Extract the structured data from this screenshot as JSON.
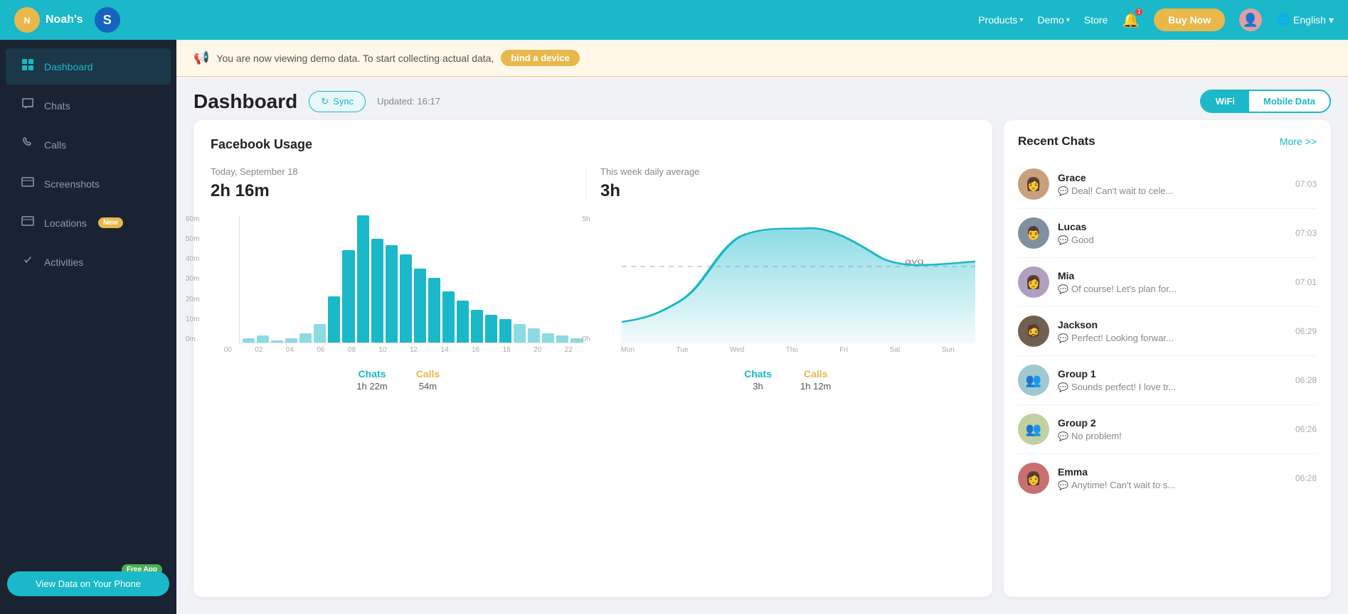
{
  "topNav": {
    "logoText": "Noah's",
    "logoIcon": "S",
    "products": "Products",
    "demo": "Demo",
    "store": "Store",
    "buyNow": "Buy Now",
    "language": "English"
  },
  "banner": {
    "text": "You are now viewing demo data. To start collecting actual data,",
    "bindBtn": "bind a device"
  },
  "dashboard": {
    "title": "Dashboard",
    "syncBtn": "Sync",
    "updated": "Updated: 16:17",
    "wifiBtn": "WiFi",
    "mobileDataBtn": "Mobile Data"
  },
  "sidebar": {
    "items": [
      {
        "id": "dashboard",
        "label": "Dashboard",
        "icon": "⊞",
        "active": true
      },
      {
        "id": "chats",
        "label": "Chats",
        "icon": "💬",
        "active": false
      },
      {
        "id": "calls",
        "label": "Calls",
        "icon": "📞",
        "active": false
      },
      {
        "id": "screenshots",
        "label": "Screenshots",
        "icon": "🖥",
        "active": false
      },
      {
        "id": "locations",
        "label": "Locations",
        "icon": "📋",
        "active": false,
        "badge": "New"
      },
      {
        "id": "activities",
        "label": "Activities",
        "icon": "✋",
        "active": false
      }
    ],
    "viewDataBtn": "View Data on Your Phone",
    "freeAppBadge": "Free App"
  },
  "facebookUsage": {
    "title": "Facebook Usage",
    "todayLabel": "Today, September 18",
    "todayTime": "2h 16m",
    "weekLabel": "This week daily average",
    "weekTime": "3h",
    "barChart": {
      "yLabels": [
        "60m",
        "50m",
        "40m",
        "30m",
        "20m",
        "10m",
        "0m"
      ],
      "xLabels": [
        "00",
        "02",
        "04",
        "06",
        "08",
        "10",
        "12",
        "14",
        "16",
        "18",
        "20",
        "22"
      ],
      "bars": [
        2,
        3,
        1,
        2,
        4,
        8,
        20,
        40,
        55,
        45,
        42,
        38,
        32,
        28,
        22,
        18,
        14,
        12,
        10,
        8,
        6,
        4,
        3,
        2
      ]
    },
    "lineChart": {
      "yLabels": [
        "5h",
        "",
        "",
        "",
        "0h"
      ],
      "xLabels": [
        "Mon",
        "Tue",
        "Wed",
        "Thu",
        "Fri",
        "Sat",
        "Sun"
      ],
      "avgLabel": "avg"
    },
    "legend": {
      "chatsLabel": "Chats",
      "chatsValue": "1h 22m",
      "callsLabel": "Calls",
      "callsValue": "54m",
      "chatsWeekLabel": "Chats",
      "chatsWeekValue": "3h",
      "callsWeekLabel": "Calls",
      "callsWeekValue": "1h 12m"
    }
  },
  "recentChats": {
    "title": "Recent Chats",
    "moreLink": "More >>",
    "items": [
      {
        "id": "grace",
        "name": "Grace",
        "preview": "Deal! Can't wait to cele...",
        "time": "07:03",
        "avatarClass": "av-grace",
        "emoji": "👩"
      },
      {
        "id": "lucas",
        "name": "Lucas",
        "preview": "Good",
        "time": "07:03",
        "avatarClass": "av-lucas",
        "emoji": "👨"
      },
      {
        "id": "mia",
        "name": "Mia",
        "preview": "Of course! Let's plan for...",
        "time": "07:01",
        "avatarClass": "av-mia",
        "emoji": "👩"
      },
      {
        "id": "jackson",
        "name": "Jackson",
        "preview": "Perfect! Looking forwar...",
        "time": "06:29",
        "avatarClass": "av-jackson",
        "emoji": "🧔"
      },
      {
        "id": "group1",
        "name": "Group 1",
        "preview": "Sounds perfect! I love tr...",
        "time": "06:28",
        "avatarClass": "av-group1",
        "emoji": "👥"
      },
      {
        "id": "group2",
        "name": "Group 2",
        "preview": "No problem!",
        "time": "06:26",
        "avatarClass": "av-group2",
        "emoji": "👥"
      },
      {
        "id": "emma",
        "name": "Emma",
        "preview": "Anytime! Can't wait to s...",
        "time": "06:28",
        "avatarClass": "av-emma",
        "emoji": "👩"
      }
    ]
  }
}
